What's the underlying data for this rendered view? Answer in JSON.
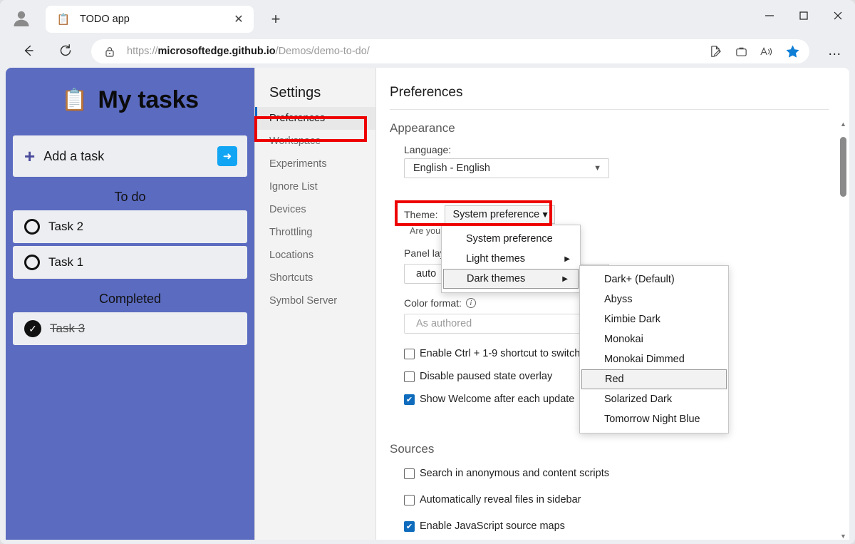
{
  "browser": {
    "profile_icon": "account-avatar-icon",
    "tab": {
      "favicon": "clipboard-icon",
      "title": "TODO app",
      "close_label": "✕"
    },
    "new_tab_label": "+",
    "window_controls": {
      "minimize": "—",
      "maximize": "□",
      "close": "✕"
    },
    "nav": {
      "back": "←",
      "reload": "↻"
    },
    "address": {
      "lock_icon": "lock-icon",
      "url_prefix": "https://",
      "url_domain": "microsoftedge.github.io",
      "url_path": "/Demos/demo-to-do/"
    },
    "omnibox_actions": [
      "editor-icon",
      "collections-icon",
      "read-aloud-icon",
      "favorite-star-icon"
    ],
    "settings_and_more": "…"
  },
  "todo_app": {
    "icon": "clipboard-icon",
    "title": "My tasks",
    "add_task": {
      "plus": "+",
      "placeholder": "Add a task",
      "submit_icon": "arrow-right-icon"
    },
    "sections": [
      {
        "heading": "To do",
        "tasks": [
          {
            "name": "Task 2",
            "done": false
          },
          {
            "name": "Task 1",
            "done": false
          }
        ]
      },
      {
        "heading": "Completed",
        "tasks": [
          {
            "name": "Task 3",
            "done": true
          }
        ]
      }
    ]
  },
  "devtools": {
    "close_label": "✕",
    "sidebar": {
      "title": "Settings",
      "items": [
        {
          "label": "Preferences",
          "active": true
        },
        {
          "label": "Workspace",
          "active": false
        },
        {
          "label": "Experiments",
          "active": false
        },
        {
          "label": "Ignore List",
          "active": false
        },
        {
          "label": "Devices",
          "active": false
        },
        {
          "label": "Throttling",
          "active": false
        },
        {
          "label": "Locations",
          "active": false
        },
        {
          "label": "Shortcuts",
          "active": false
        },
        {
          "label": "Symbol Server",
          "active": false
        }
      ]
    },
    "preferences": {
      "title": "Preferences",
      "appearance": {
        "group_title": "Appearance",
        "language_label": "Language:",
        "language_value": "English - English",
        "theme_label": "Theme:",
        "theme_value": "System preference",
        "theme_note": "Are you",
        "panel_layout_label": "Panel lay",
        "panel_layout_value": "auto",
        "color_format_label": "Color format:",
        "color_format_value": "As authored",
        "checkboxes": [
          {
            "label": "Enable Ctrl + 1-9 shortcut to switch",
            "checked": false
          },
          {
            "label": "Disable paused state overlay",
            "checked": false
          },
          {
            "label": "Show Welcome after each update",
            "checked": true
          }
        ]
      },
      "sources": {
        "group_title": "Sources",
        "checkboxes": [
          {
            "label": "Search in anonymous and content scripts",
            "checked": false
          },
          {
            "label": "Automatically reveal files in sidebar",
            "checked": false
          },
          {
            "label": "Enable JavaScript source maps",
            "checked": true
          }
        ]
      }
    },
    "theme_menu": {
      "items": [
        {
          "label": "System preference",
          "has_submenu": false,
          "highlighted": false
        },
        {
          "label": "Light themes",
          "has_submenu": true,
          "highlighted": false
        },
        {
          "label": "Dark themes",
          "has_submenu": true,
          "highlighted": true
        }
      ],
      "submenu_arrow": "▶"
    },
    "dark_themes_submenu": {
      "items": [
        {
          "label": "Dark+ (Default)",
          "highlighted": false
        },
        {
          "label": "Abyss",
          "highlighted": false
        },
        {
          "label": "Kimbie Dark",
          "highlighted": false
        },
        {
          "label": "Monokai",
          "highlighted": false
        },
        {
          "label": "Monokai Dimmed",
          "highlighted": false
        },
        {
          "label": "Red",
          "highlighted": true
        },
        {
          "label": "Solarized Dark",
          "highlighted": false
        },
        {
          "label": "Tomorrow Night Blue",
          "highlighted": false
        }
      ]
    },
    "scrollbar": {
      "up_arrow": "▲",
      "down_arrow": "▼"
    }
  },
  "annotations": {
    "highlight_color": "#ee0000",
    "boxes": [
      "preferences-sidebar-item",
      "theme-dropdown"
    ]
  },
  "colors": {
    "todo_bg": "#5b6bc0",
    "accent_blue": "#0f6cbd",
    "submit_blue": "#12a5f4",
    "chrome_bg": "#eceef1"
  }
}
